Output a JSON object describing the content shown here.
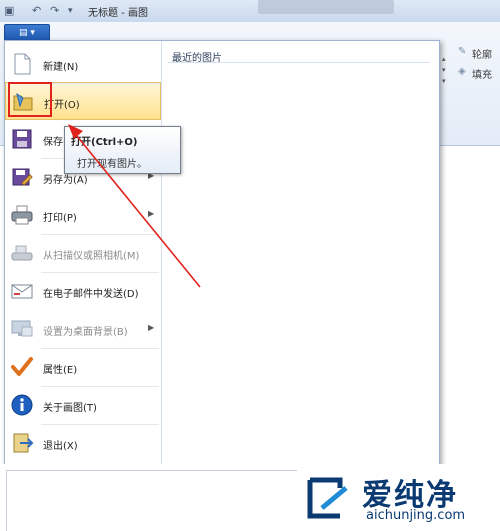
{
  "window": {
    "title": "无标题 - 画图",
    "quick_access": [
      "↶",
      "↷",
      "▾"
    ]
  },
  "app_menu_button": {
    "label": "▤ ▾"
  },
  "menu": {
    "recent_title": "最近的图片",
    "items": [
      {
        "label": "新建(N)",
        "icon": "new-file-icon",
        "enabled": true,
        "submenu": false
      },
      {
        "label": "打开(O)",
        "icon": "open-folder-icon",
        "enabled": true,
        "submenu": false,
        "highlighted": true
      },
      {
        "label": "保存(S)",
        "icon": "save-icon",
        "enabled": true,
        "submenu": false
      },
      {
        "label": "另存为(A)",
        "icon": "save-as-icon",
        "enabled": true,
        "submenu": true
      },
      {
        "label": "打印(P)",
        "icon": "print-icon",
        "enabled": true,
        "submenu": true
      },
      {
        "label": "从扫描仪或照相机(M)",
        "icon": "scanner-icon",
        "enabled": false,
        "submenu": false
      },
      {
        "label": "在电子邮件中发送(D)",
        "icon": "email-icon",
        "enabled": true,
        "submenu": false
      },
      {
        "label": "设置为桌面背景(B)",
        "icon": "desktop-background-icon",
        "enabled": false,
        "submenu": true
      },
      {
        "label": "属性(E)",
        "icon": "properties-checkmark-icon",
        "enabled": true,
        "submenu": false
      },
      {
        "label": "关于画图(T)",
        "icon": "info-icon",
        "enabled": true,
        "submenu": false
      },
      {
        "label": "退出(X)",
        "icon": "exit-icon",
        "enabled": true,
        "submenu": false
      }
    ]
  },
  "tooltip": {
    "title": "打开(Ctrl+O)",
    "description": "打开现有图片。"
  },
  "ribbon_right": {
    "items": [
      "轮廓",
      "填充"
    ]
  },
  "watermark": {
    "text": "爱纯净",
    "url": "aichunjing.com"
  },
  "colors": {
    "highlight": "#ffe28e",
    "annotation_red": "#e0231c",
    "watermark_blue": "#0b3a72"
  }
}
